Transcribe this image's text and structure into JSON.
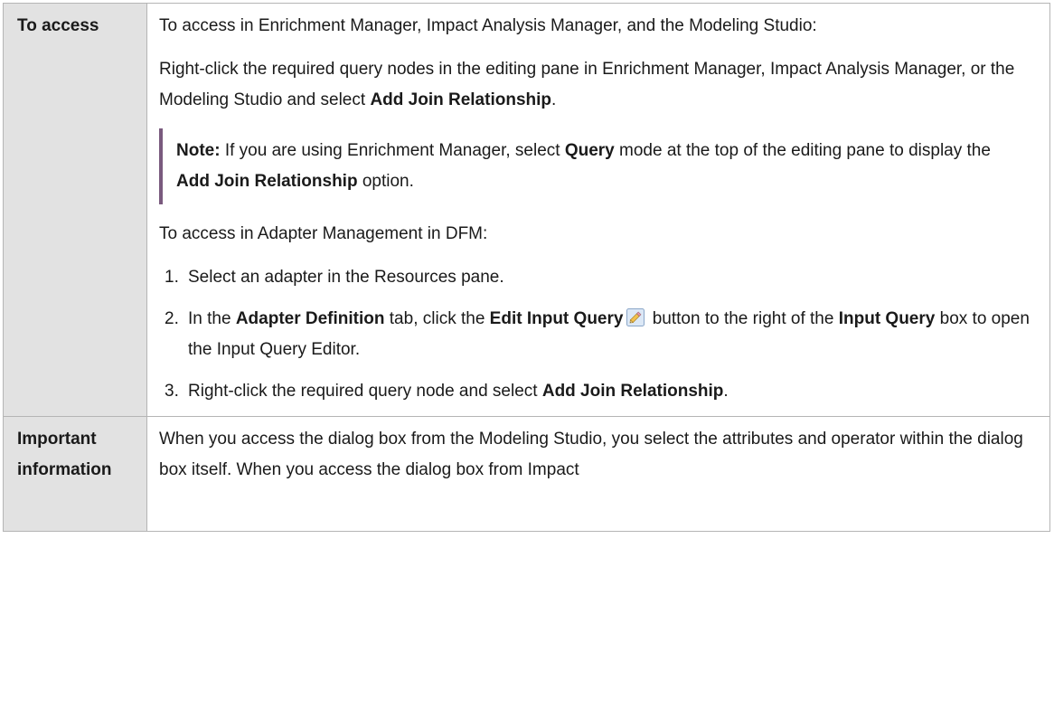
{
  "table": {
    "access": {
      "label": "To access",
      "intro": "To access in Enrichment Manager, Impact Analysis Manager, and the Modeling Studio:",
      "rightclick": {
        "before": "Right-click the required query nodes in the editing pane in Enrichment Manager, Impact Analysis Manager, or the Modeling Studio and select ",
        "bold": "Add Join Relationship",
        "after": "."
      },
      "note": {
        "label": "Note:",
        "t1": " If you are using Enrichment Manager, select ",
        "b1": "Query",
        "t2": " mode at the top of the editing pane to display the ",
        "b2": "Add Join Relationship",
        "t3": " option."
      },
      "dfm_intro": "To access in Adapter Management in DFM:",
      "steps": [
        {
          "num": "1.",
          "text": "Select an adapter in the Resources pane."
        },
        {
          "num": "2.",
          "t1": "In the ",
          "b1": "Adapter Definition",
          "t2": " tab, click the ",
          "b2": "Edit Input Query",
          "t3": " button to the right of the ",
          "b3": "Input Query",
          "t4": " box to open the Input Query Editor.",
          "icon": "pencil-edit-icon"
        },
        {
          "num": "3.",
          "t1": "Right-click the required query node and select ",
          "b1": "Add Join Relationship",
          "t2": "."
        }
      ]
    },
    "important": {
      "label": "Important information",
      "text": "When you access the dialog box from the Modeling Studio, you select the attributes and operator within the dialog box itself. When you access the dialog box from Impact"
    }
  },
  "colors": {
    "label_bg": "#e2e2e2",
    "border": "#b5b5b5",
    "note_bar": "#7a5a7e",
    "text": "#1a1a1a"
  }
}
